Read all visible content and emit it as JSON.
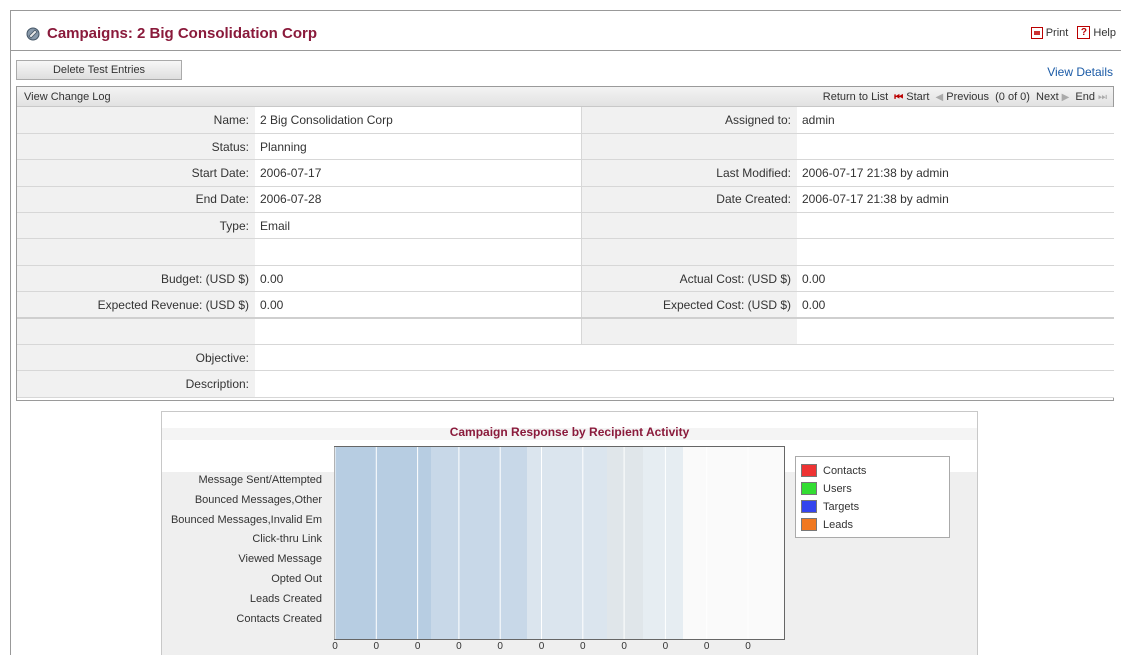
{
  "header": {
    "title": "Campaigns: 2 Big Consolidation Corp",
    "print_label": "Print",
    "help_label": "Help",
    "help_glyph": "?"
  },
  "actions": {
    "delete_test_entries": "Delete Test Entries",
    "view_details": "View Details"
  },
  "navbar": {
    "change_log": "View Change Log",
    "return_to_list": "Return to List",
    "start": "Start",
    "previous": "Previous",
    "count": "(0 of 0)",
    "next": "Next",
    "end": "End"
  },
  "fields": {
    "name": {
      "label": "Name:",
      "value": "2 Big Consolidation Corp"
    },
    "assigned_to": {
      "label": "Assigned to:",
      "value": "admin"
    },
    "status": {
      "label": "Status:",
      "value": "Planning"
    },
    "start_date": {
      "label": "Start Date:",
      "value": "2006-07-17"
    },
    "last_modified": {
      "label": "Last Modified:",
      "value": "2006-07-17 21:38 by admin"
    },
    "end_date": {
      "label": "End Date:",
      "value": "2006-07-28"
    },
    "date_created": {
      "label": "Date Created:",
      "value": "2006-07-17 21:38 by admin"
    },
    "type": {
      "label": "Type:",
      "value": "Email"
    },
    "budget": {
      "label": "Budget: (USD $)",
      "value": "0.00"
    },
    "actual_cost": {
      "label": "Actual Cost: (USD $)",
      "value": "0.00"
    },
    "expected_revenue": {
      "label": "Expected Revenue: (USD $)",
      "value": "0.00"
    },
    "expected_cost": {
      "label": "Expected Cost: (USD $)",
      "value": "0.00"
    },
    "objective": {
      "label": "Objective:",
      "value": ""
    },
    "description": {
      "label": "Description:",
      "value": ""
    }
  },
  "chart_data": {
    "type": "bar",
    "title": "Campaign Response by Recipient Activity",
    "categories": [
      "Message Sent/Attempted",
      "Bounced Messages,Other",
      "Bounced Messages,Invalid Em",
      "Click-thru Link",
      "Viewed Message",
      "Opted Out",
      "Leads Created",
      "Contacts Created"
    ],
    "series": [
      {
        "name": "Contacts",
        "color": "#ee3333",
        "values": [
          0,
          0,
          0,
          0,
          0,
          0,
          0,
          0
        ]
      },
      {
        "name": "Users",
        "color": "#33dd33",
        "values": [
          0,
          0,
          0,
          0,
          0,
          0,
          0,
          0
        ]
      },
      {
        "name": "Targets",
        "color": "#3344ee",
        "values": [
          0,
          0,
          0,
          0,
          0,
          0,
          0,
          0
        ]
      },
      {
        "name": "Leads",
        "color": "#f07820",
        "values": [
          0,
          0,
          0,
          0,
          0,
          0,
          0,
          0
        ]
      }
    ],
    "xticks": [
      "0",
      "0",
      "0",
      "0",
      "0",
      "0",
      "0",
      "0",
      "0",
      "0",
      "0"
    ],
    "legend_position": "right",
    "orientation": "horizontal"
  }
}
